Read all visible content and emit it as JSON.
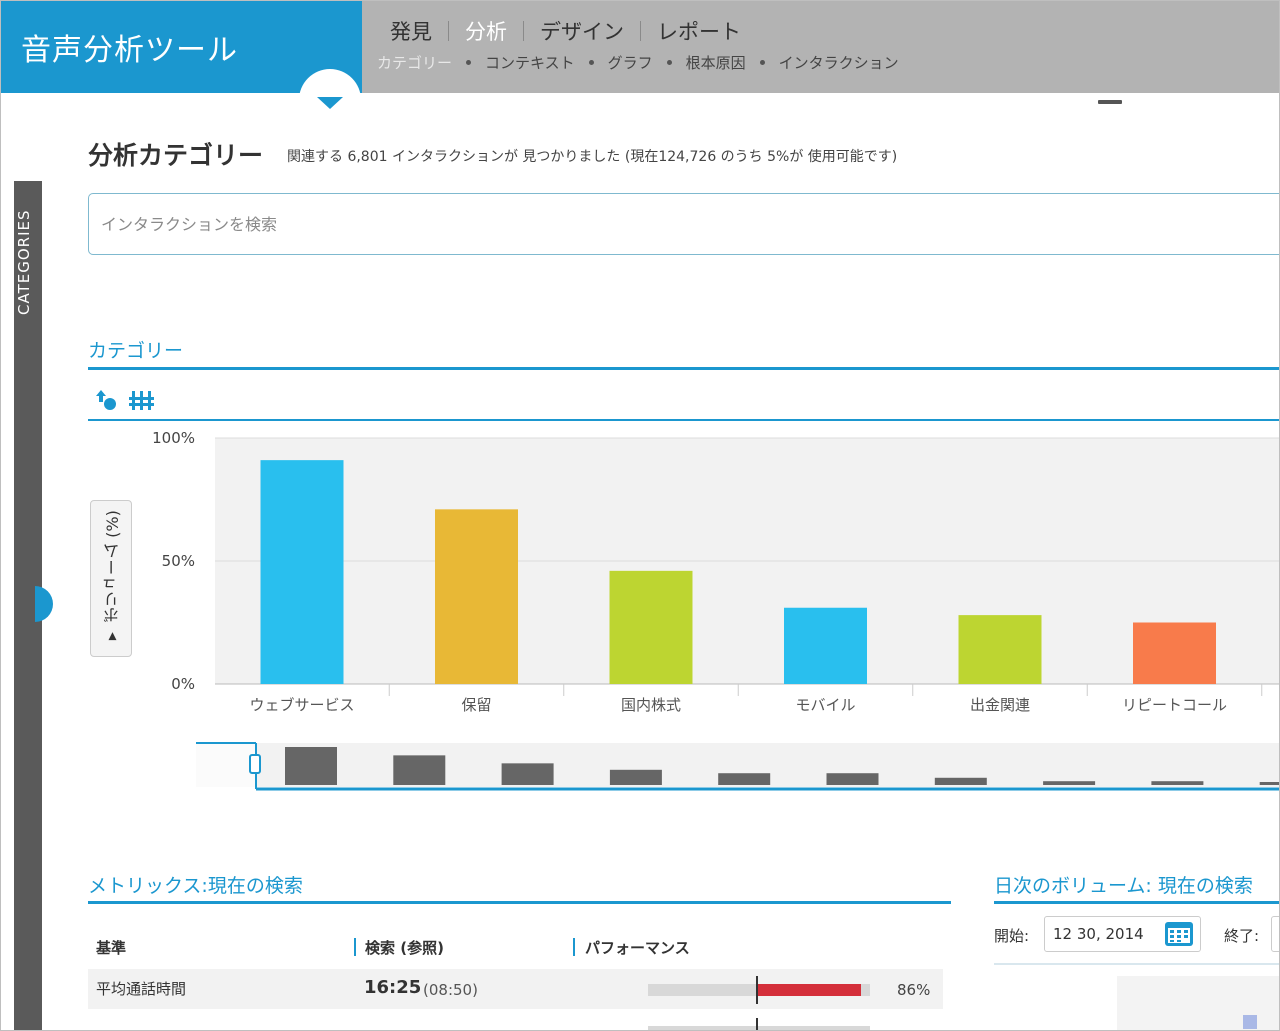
{
  "app": {
    "title": "音声分析ツール"
  },
  "nav": {
    "main_tabs": [
      {
        "label": "発見",
        "active": false
      },
      {
        "label": "分析",
        "active": true
      },
      {
        "label": "デザイン",
        "active": false
      },
      {
        "label": "レポート",
        "active": false
      }
    ],
    "sub_tabs": [
      {
        "label": "カテゴリー",
        "active": true
      },
      {
        "label": "コンテキスト",
        "active": false
      },
      {
        "label": "グラフ",
        "active": false
      },
      {
        "label": "根本原因",
        "active": false
      },
      {
        "label": "インタラクション",
        "active": false
      }
    ],
    "menu_icon": "hamburger-icon"
  },
  "sidebar": {
    "label": "CATEGORIES"
  },
  "page": {
    "title": "分析カテゴリー",
    "summary": "関連する 6,801 インタラクションが 見つかりました (現在124,726 のうち 5%が 使用可能です)"
  },
  "search": {
    "placeholder": "インタラクションを検索"
  },
  "categories_section": {
    "title": "カテゴリー",
    "tools": [
      "sort-icon",
      "filter-columns-icon"
    ],
    "yaxis_toggle": "▾ ボリューム (%)"
  },
  "chart_data": {
    "type": "bar",
    "title": "",
    "xlabel": "",
    "ylabel": "ボリューム (%)",
    "ylim": [
      0,
      100
    ],
    "yticks": [
      "100%",
      "50%",
      "0%"
    ],
    "categories": [
      "ウェブサービス",
      "保留",
      "国内株式",
      "モバイル",
      "出金関連",
      "リピートコール"
    ],
    "values": [
      91,
      71,
      46,
      31,
      28,
      25
    ],
    "colors": [
      "#29bfee",
      "#e8b836",
      "#bdd531",
      "#29bfee",
      "#bdd531",
      "#f87b4b"
    ],
    "grid": true,
    "overview_values": [
      100,
      78,
      57,
      40,
      31,
      31,
      19,
      10,
      10,
      6
    ]
  },
  "metrics": {
    "title": "メトリックス:現在の検索",
    "headers": [
      "基準",
      "検索 (参照)",
      "パフォーマンス"
    ],
    "rows": [
      {
        "name": "平均通話時間",
        "value": "16:25",
        "ref": "(08:50)",
        "pct": "86%",
        "performance": 0.86
      }
    ]
  },
  "daily_volume": {
    "title": "日次のボリューム: 現在の検索",
    "start_label": "開始:",
    "start_value": "12 30, 2014",
    "end_label": "終了:"
  }
}
